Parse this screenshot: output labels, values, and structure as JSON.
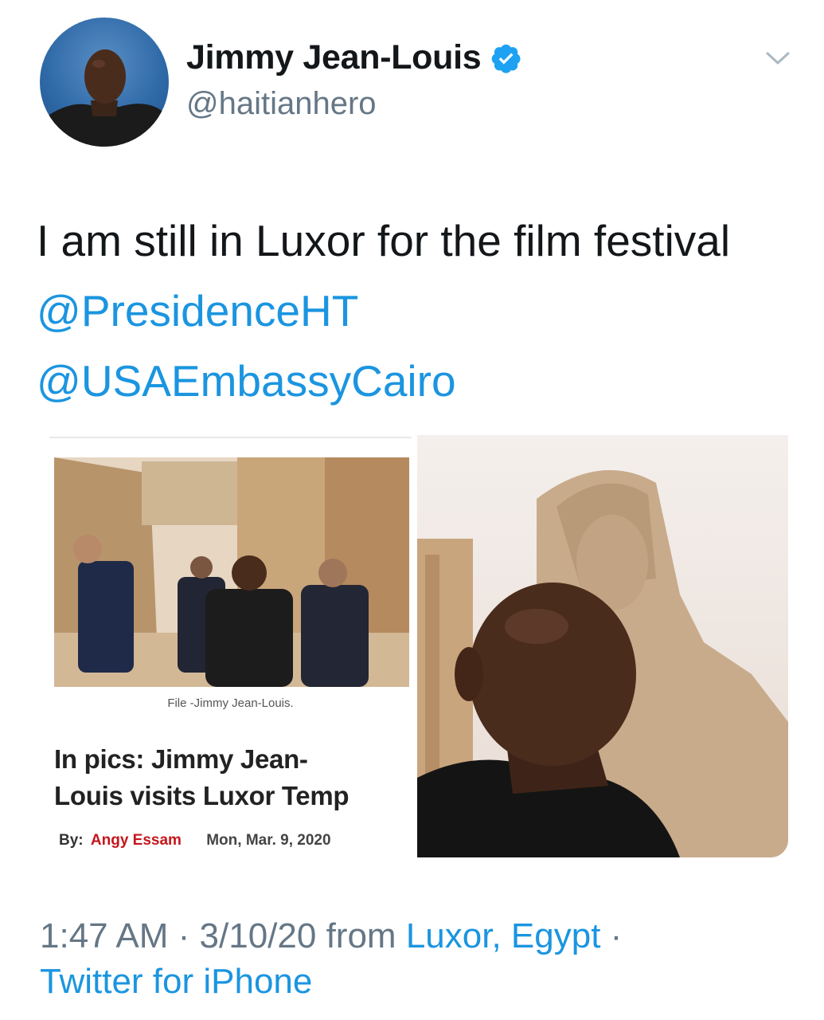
{
  "author": {
    "display_name": "Jimmy Jean-Louis",
    "handle": "@haitianhero",
    "verified": true,
    "avatar_icon": "profile-photo"
  },
  "tweet": {
    "text_before": "I am still in Luxor for the film festival ",
    "mentions": [
      "@PresidenceHT",
      "@USAEmbassyCairo"
    ]
  },
  "media": {
    "news_card": {
      "caption": "File -Jimmy Jean-Louis.",
      "headline_line1": "In pics: Jimmy Jean-",
      "headline_line2": "Louis visits Luxor Temp",
      "by_label": "By:",
      "author": "Angy Essam",
      "date": "Mon, Mar. 9, 2020"
    },
    "photo_icon": "portrait-photo"
  },
  "meta": {
    "time": "1:47 AM",
    "separator": " · ",
    "date": "3/10/20",
    "from_label": " from ",
    "location": "Luxor, Egypt",
    "trailing_separator": " ·",
    "source": "Twitter for iPhone"
  },
  "colors": {
    "link": "#1b95e0",
    "secondary_text": "#657786",
    "byline_author": "#c4161c"
  }
}
